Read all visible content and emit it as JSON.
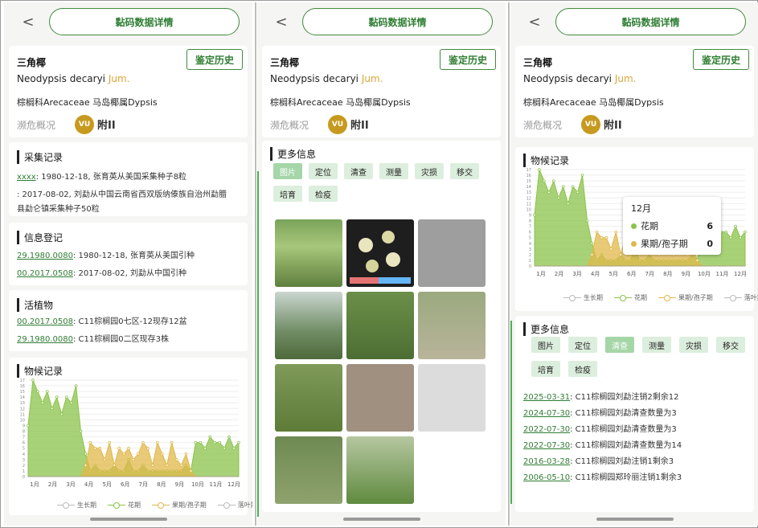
{
  "header": {
    "back_icon": "back-arrow-icon",
    "back": "<",
    "title": "黏码数据详情"
  },
  "plant": {
    "name": "三角椰",
    "latin": "Neodypsis decaryi",
    "author": "Jum.",
    "family": "棕榈科Arecaceae 马岛椰属Dypsis",
    "status_label": "濒危概况",
    "iucn": "VU",
    "cites": "附II",
    "history_btn": "鉴定历史"
  },
  "collection": {
    "title": "采集记录",
    "items": [
      {
        "code": "xxxx",
        "text": ": 1980-12-18, 张育英从美国采集种子8粒"
      },
      {
        "code": "",
        "text": ": 2017-08-02, 刘勐从中国云南省西双版纳傣族自治州勐腊"
      },
      {
        "code": "",
        "text": "县勐仑镇采集种子50粒"
      }
    ]
  },
  "registration": {
    "title": "信息登记",
    "items": [
      {
        "code": "29.1980.0080",
        "text": ": 1980-12-18, 张育英从美国引种"
      },
      {
        "code": "00.2017.0508",
        "text": ": 2017-08-02, 刘勐从中国引种"
      }
    ]
  },
  "living": {
    "title": "活植物",
    "items": [
      {
        "code": "00.2017.0508",
        "text": ": C11棕榈园0七区-12现存12盆"
      },
      {
        "code": "29.1980.0080",
        "text": ": C11棕榈园0二区现存3株"
      }
    ]
  },
  "phenology": {
    "title": "物候记录",
    "legend": [
      "生长期",
      "花期",
      "果期/孢子期",
      "落叶期"
    ],
    "tooltip": {
      "month": "12月",
      "rows": [
        {
          "label": "花期",
          "value": "6"
        },
        {
          "label": "果期/孢子期",
          "value": "0"
        }
      ]
    }
  },
  "more": {
    "title": "更多信息",
    "buttons": [
      "图片",
      "定位",
      "清查",
      "测量",
      "灾损",
      "移交",
      "培育",
      "检疫"
    ]
  },
  "history": {
    "items": [
      {
        "date": "2025-03-31",
        "text": ": C11棕榈园刘勐注销2剩余12"
      },
      {
        "date": "2024-07-30",
        "text": ": C11棕榈园刘勐清查数量为3"
      },
      {
        "date": "2022-07-30",
        "text": ": C11棕榈园刘勐清查数量为3"
      },
      {
        "date": "2022-07-30",
        "text": ": C11棕榈园刘勐清查数量为14"
      },
      {
        "date": "2016-03-28",
        "text": ": C11棕榈园刘勐注销1剩余3"
      },
      {
        "date": "2006-05-10",
        "text": ": C11棕榈园郑玲丽注销1剩余3"
      }
    ]
  },
  "chart_data": {
    "type": "area",
    "x_ticks": [
      "1月",
      "2月",
      "3月",
      "4月",
      "5月",
      "6月",
      "7月",
      "8月",
      "9月",
      "10月",
      "11月",
      "12月"
    ],
    "ylim": [
      0,
      17
    ],
    "y_ticks": [
      "0",
      "1",
      "2",
      "3",
      "4",
      "5",
      "6",
      "7",
      "8",
      "9",
      "10",
      "11",
      "12",
      "13",
      "14",
      "15",
      "16",
      "17"
    ],
    "series": [
      {
        "name": "花期",
        "color": "#8bc34a",
        "values": [
          9,
          17,
          15,
          13,
          15,
          12,
          14,
          11,
          14,
          13,
          16,
          8,
          4,
          1,
          2,
          1,
          1,
          1,
          2,
          1,
          1,
          3,
          1,
          1,
          2,
          1,
          1,
          1,
          1,
          1,
          1,
          1,
          1,
          2,
          1,
          6,
          6,
          5,
          7,
          6,
          6,
          5,
          7,
          5,
          6
        ]
      },
      {
        "name": "果期/孢子期",
        "color": "#e0b84a",
        "values": [
          0,
          0,
          0,
          0,
          0,
          0,
          0,
          0,
          0,
          0,
          0,
          0,
          2,
          6,
          5,
          5,
          3,
          6,
          2,
          5,
          4,
          5,
          3,
          4,
          6,
          5,
          2,
          6,
          4,
          2,
          6,
          3,
          2,
          4,
          1,
          0,
          0,
          0,
          0,
          0,
          0,
          0,
          0,
          0,
          0
        ]
      }
    ]
  }
}
